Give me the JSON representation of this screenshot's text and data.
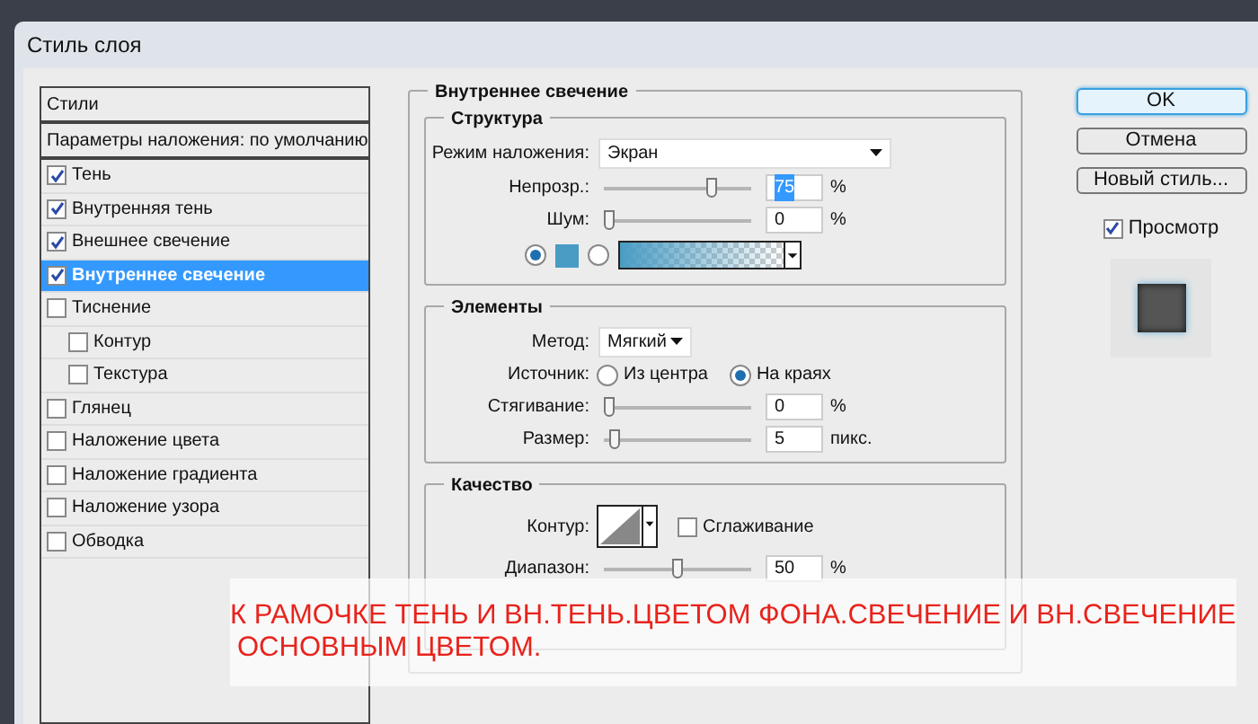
{
  "window": {
    "title": "Стиль слоя"
  },
  "styles_panel": {
    "header": "Стили",
    "blending_options": "Параметры наложения: по умолчанию",
    "items": [
      {
        "label": "Тень",
        "checked": true,
        "selected": false
      },
      {
        "label": "Внутренняя тень",
        "checked": true,
        "selected": false
      },
      {
        "label": "Внешнее свечение",
        "checked": true,
        "selected": false
      },
      {
        "label": "Внутреннее свечение",
        "checked": true,
        "selected": true
      },
      {
        "label": "Тиснение",
        "checked": false,
        "selected": false,
        "children": [
          {
            "label": "Контур",
            "checked": false,
            "selected": false
          },
          {
            "label": "Текстура",
            "checked": false,
            "selected": false
          }
        ]
      },
      {
        "label": "Глянец",
        "checked": false,
        "selected": false
      },
      {
        "label": "Наложение цвета",
        "checked": false,
        "selected": false
      },
      {
        "label": "Наложение градиента",
        "checked": false,
        "selected": false
      },
      {
        "label": "Наложение узора",
        "checked": false,
        "selected": false
      },
      {
        "label": "Обводка",
        "checked": false,
        "selected": false
      }
    ]
  },
  "effect": {
    "title": "Внутреннее свечение",
    "structure": {
      "title": "Структура",
      "blend_mode": {
        "label": "Режим наложения:",
        "value": "Экран"
      },
      "sliders": [
        {
          "label": "Непрозр.:",
          "level": 0.75,
          "value": "75",
          "unit": "%",
          "value_selected": true
        },
        {
          "label": "Шум:",
          "level": 0,
          "value": "0",
          "unit": "%",
          "value_selected": false
        }
      ],
      "fill_options": [
        {
          "kind": "color",
          "selected": true,
          "color": "#4a9cc4"
        },
        {
          "kind": "gradient",
          "selected": false,
          "color": "#4a9cc4"
        }
      ]
    },
    "elements": {
      "title": "Элементы",
      "method": {
        "label": "Метод:",
        "value": "Мягкий"
      },
      "source": {
        "label": "Источник:",
        "options": [
          {
            "label": "Из центра",
            "selected": false
          },
          {
            "label": "На краях",
            "selected": true
          }
        ]
      },
      "sliders": [
        {
          "label": "Стягивание:",
          "level": 0,
          "value": "0",
          "unit": "%",
          "value_selected": false
        },
        {
          "label": "Размер:",
          "level": 0.04,
          "value": "5",
          "unit": "пикс.",
          "value_selected": false
        }
      ]
    },
    "quality": {
      "title": "Качество",
      "contour_label": "Контур:",
      "antialias": {
        "label": "Сглаживание",
        "checked": false
      },
      "sliders": [
        {
          "label": "Диапазон:",
          "level": 0.5,
          "value": "50",
          "unit": "%",
          "value_selected": false
        }
      ]
    }
  },
  "actions": [
    {
      "label": "OK",
      "default": true
    },
    {
      "label": "Отмена",
      "default": false
    },
    {
      "label": "Новый стиль...",
      "default": false
    }
  ],
  "preview": {
    "label": "Просмотр",
    "checked": true
  },
  "annotation": [
    "К РАМОЧКЕ ТЕНЬ И ВН.ТЕНЬ.ЦВЕТОМ ФОНА.СВЕЧЕНИЕ И ВН.СВЕЧЕНИЕ",
    "ОСНОВНЫМ ЦВЕТОМ."
  ]
}
